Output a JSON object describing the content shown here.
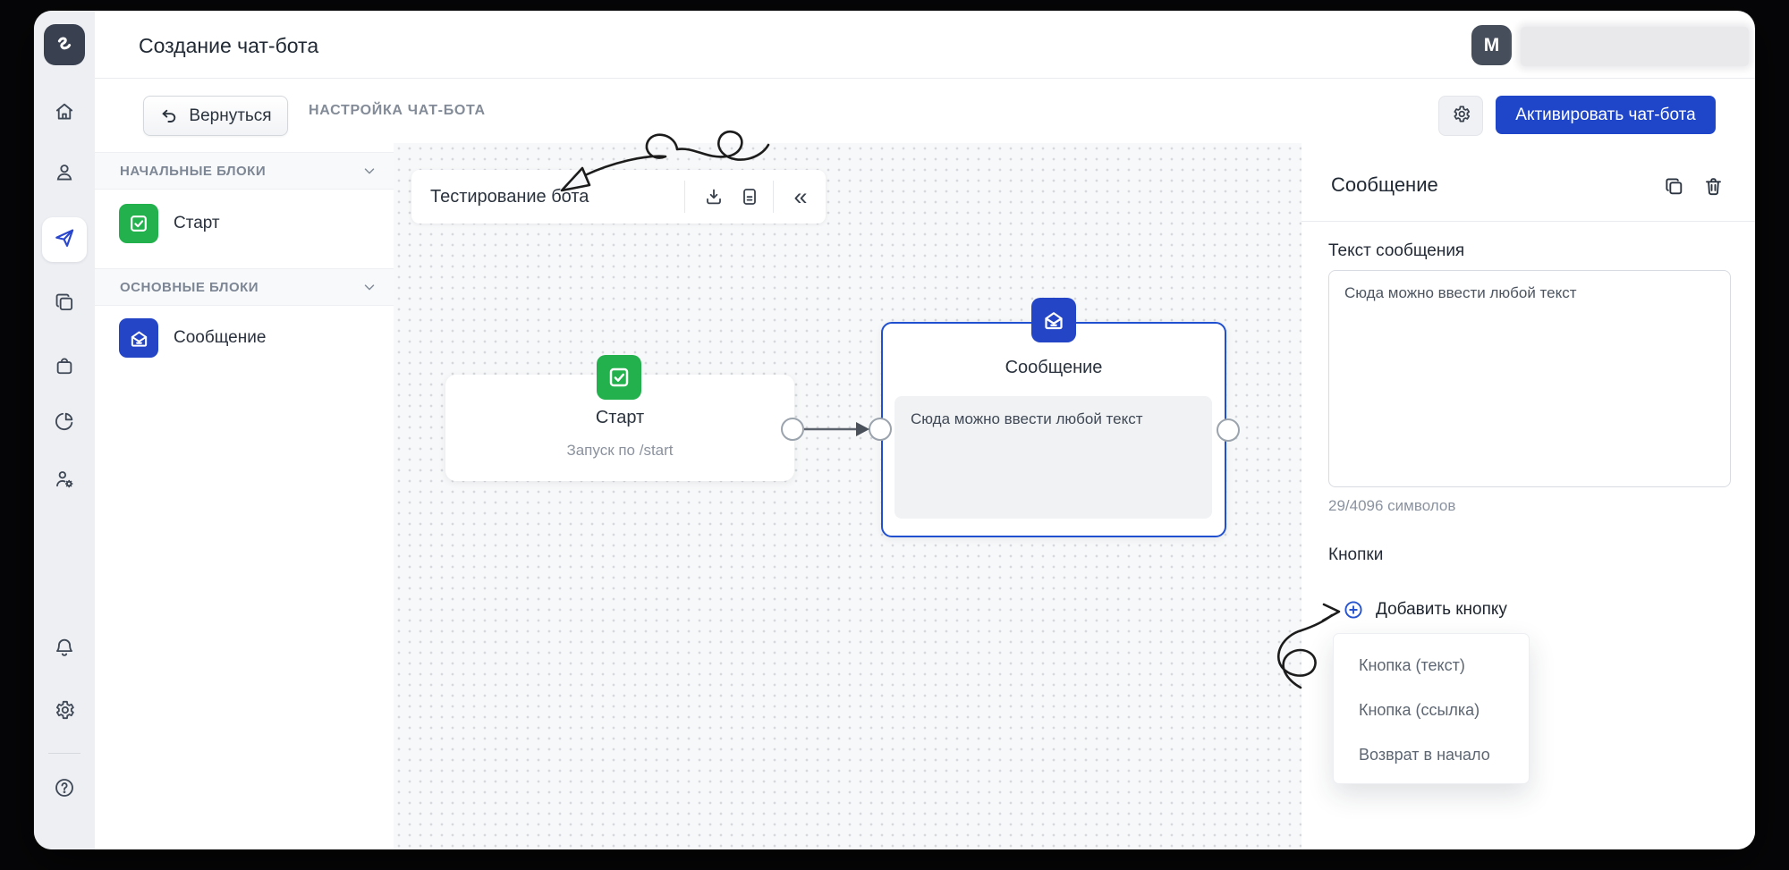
{
  "header": {
    "title": "Создание чат-бота",
    "avatar_initial": "M"
  },
  "toolbar": {
    "back": "Вернуться",
    "breadcrumb": "НАСТРОЙКА ЧАТ-БОТА",
    "activate": "Активировать чат-бота"
  },
  "rail": {
    "icons": [
      "logo",
      "home-icon",
      "user-icon",
      "paper-plane-icon",
      "pages-icon",
      "shop-bag-icon",
      "pie-chart-icon",
      "user-gear-icon",
      "bell-icon",
      "gear-icon",
      "help-icon"
    ],
    "active": "paper-plane-icon"
  },
  "blocks": {
    "section_start": "НАЧАЛЬНЫЕ БЛОКИ",
    "section_main": "ОСНОВНЫЕ БЛОКИ",
    "start_label": "Старт",
    "message_label": "Сообщение"
  },
  "canvas": {
    "bot_name": "Тестирование бота",
    "toolbar_icons": [
      "download-icon",
      "document-icon",
      "collapse-icon"
    ],
    "collapse_glyph": "«",
    "start_node": {
      "title": "Старт",
      "subtitle": "Запуск по /start"
    },
    "message_node": {
      "title": "Сообщение",
      "body": "Сюда можно ввести любой текст"
    }
  },
  "inspector": {
    "title": "Сообщение",
    "text_label": "Текст сообщения",
    "text_value": "Сюда можно ввести любой текст",
    "counter": "29/4096 символов",
    "buttons_label": "Кнопки",
    "add_button": "Добавить кнопку",
    "menu": [
      "Кнопка (текст)",
      "Кнопка (ссылка)",
      "Возврат в начало"
    ]
  },
  "colors": {
    "accent_blue": "#1f46c9",
    "green": "#22b14c",
    "node_border_blue": "#2050d0"
  }
}
